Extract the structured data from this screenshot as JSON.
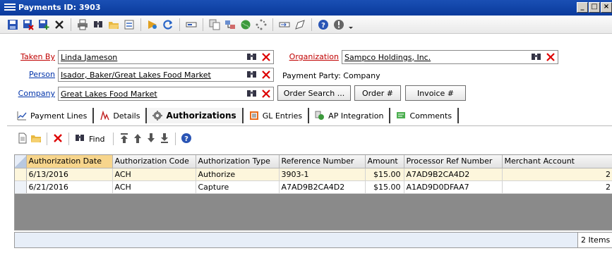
{
  "window": {
    "title": "Payments ID: 3903"
  },
  "form": {
    "taken_by": {
      "label": "Taken By",
      "value": "Linda Jameson"
    },
    "person": {
      "label": "Person",
      "value": "Isador, Baker/Great Lakes Food Market"
    },
    "company": {
      "label": "Company",
      "value": "Great Lakes Food Market"
    },
    "organization": {
      "label": "Organization",
      "value": "Sampco Holdings, Inc."
    },
    "payment_party": "Payment Party: Company",
    "buttons": {
      "order_search": "Order Search ...",
      "order_num": "Order #",
      "invoice_num": "Invoice #"
    }
  },
  "tabs": [
    {
      "label": "Payment Lines",
      "icon": "chart-line-icon"
    },
    {
      "label": "Details",
      "icon": "details-icon"
    },
    {
      "label": "Authorizations",
      "icon": "gear-icon",
      "active": true
    },
    {
      "label": "GL Entries",
      "icon": "ledger-icon"
    },
    {
      "label": "AP Integration",
      "icon": "integration-icon"
    },
    {
      "label": "Comments",
      "icon": "comment-icon"
    }
  ],
  "subtoolbar": {
    "find_label": "Find"
  },
  "grid": {
    "columns": [
      "Authorization Date",
      "Authorization Code",
      "Authorization Type",
      "Reference Number",
      "Amount",
      "Processor Ref Number",
      "Merchant Account"
    ],
    "rows": [
      [
        "6/13/2016",
        "ACH",
        "Authorize",
        "3903-1",
        "$15.00",
        "A7AD9B2CA4D2",
        "2"
      ],
      [
        "6/21/2016",
        "ACH",
        "Capture",
        "A7AD9B2CA4D2",
        "$15.00",
        "A1AD9D0DFAA7",
        "2"
      ]
    ]
  },
  "status": {
    "count": "2 Items"
  },
  "colors": {
    "title_bar": "#0a3a9c",
    "required_label": "#c00000",
    "link_label": "#0033aa",
    "selected_header": "#f7d58c"
  }
}
